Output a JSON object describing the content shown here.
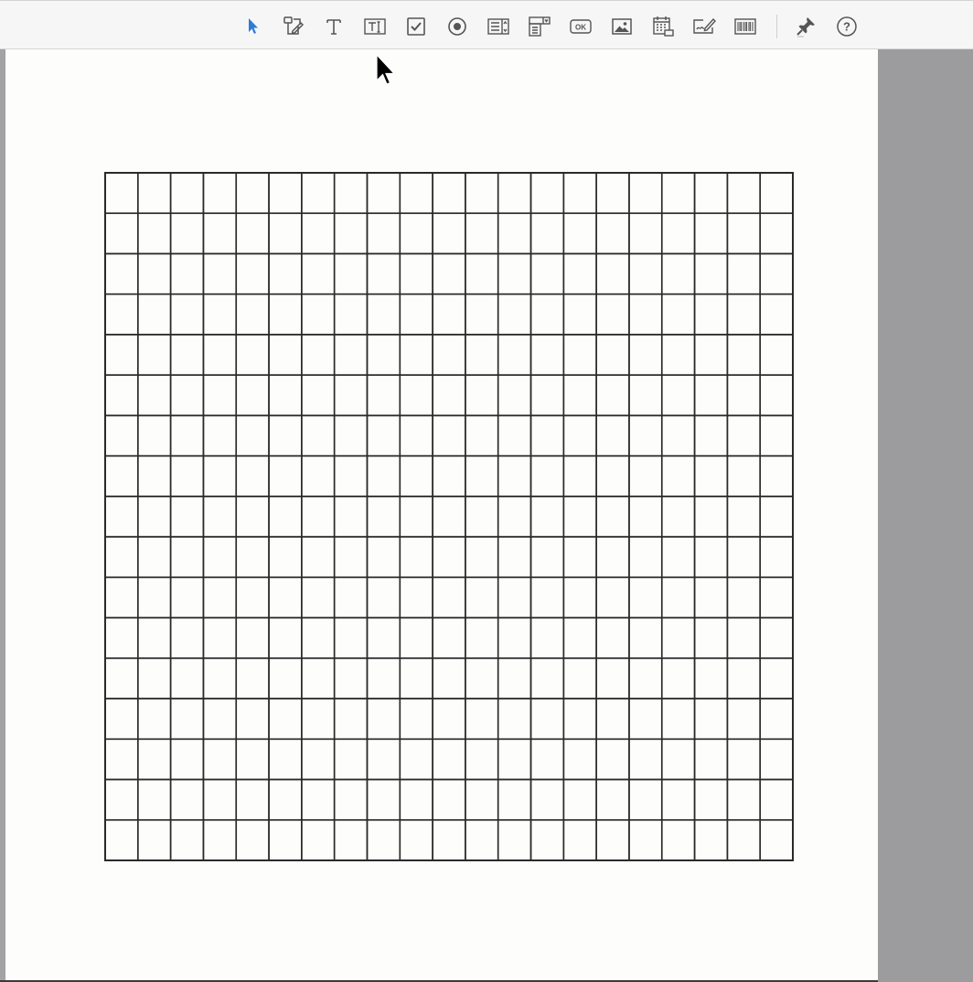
{
  "toolbar": {
    "tools": [
      {
        "id": "select",
        "icon": "select-arrow-icon",
        "active": true
      },
      {
        "id": "edit-form",
        "icon": "edit-form-icon"
      },
      {
        "id": "add-text",
        "icon": "text-t-icon"
      },
      {
        "id": "text-field",
        "icon": "text-field-icon"
      },
      {
        "id": "checkbox",
        "icon": "checkbox-icon"
      },
      {
        "id": "radio-button",
        "icon": "radio-button-icon"
      },
      {
        "id": "list-box",
        "icon": "list-box-icon"
      },
      {
        "id": "dropdown",
        "icon": "dropdown-icon"
      },
      {
        "id": "button",
        "icon": "ok-button-icon",
        "label": "OK"
      },
      {
        "id": "image-field",
        "icon": "image-icon"
      },
      {
        "id": "date-field",
        "icon": "calendar-icon"
      },
      {
        "id": "signature-field",
        "icon": "signature-icon"
      },
      {
        "id": "barcode",
        "icon": "barcode-icon"
      },
      {
        "id": "pin",
        "icon": "pin-icon"
      },
      {
        "id": "help",
        "icon": "help-icon",
        "label": "?"
      }
    ]
  },
  "colors": {
    "active_tool": "#2d7bd6",
    "icon": "#5a5a5c",
    "grid_line": "#2a2a2a"
  },
  "document": {
    "grid_rows": 17,
    "grid_cols": 21
  }
}
